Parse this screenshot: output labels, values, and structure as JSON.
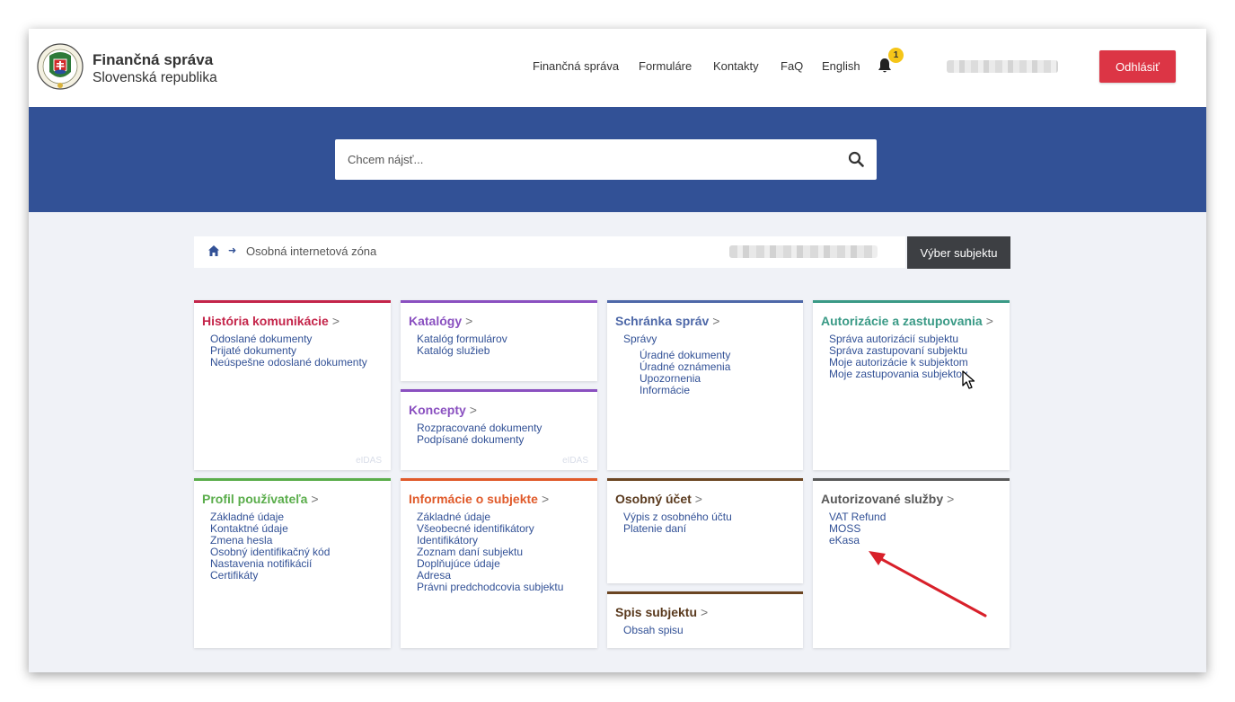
{
  "brand": {
    "title": "Finančná správa",
    "subtitle": "Slovenská republika"
  },
  "nav": [
    {
      "label": "Finančná správa"
    },
    {
      "label": "Formuláre"
    },
    {
      "label": "Kontakty"
    },
    {
      "label": "FaQ"
    },
    {
      "label": "English"
    }
  ],
  "notifications": {
    "count": "1"
  },
  "logout_label": "Odhlásiť",
  "search": {
    "placeholder": "Chcem nájsť..."
  },
  "breadcrumb": {
    "current": "Osobná internetová zóna"
  },
  "subject_button_label": "Výber subjektu",
  "eidas_label": "eIDAS",
  "colors": {
    "banner": "#325196",
    "logout": "#dc3545",
    "historia": "#c4254a",
    "katalogy": "#8a50c0",
    "schranka": "#4e68a8",
    "autorizacie": "#3a9a86",
    "profil": "#5aad4b",
    "informacie": "#e05a2a",
    "ucet": "#6b4522",
    "sluzby": "#595959",
    "link": "#325196"
  },
  "tiles": [
    {
      "title": "História komunikácie",
      "items": [
        "Odoslané dokumenty",
        "Prijaté dokumenty",
        "Neúspešne odoslané dokumenty"
      ]
    },
    {
      "title": "Katalógy",
      "items": [
        "Katalóg formulárov",
        "Katalóg služieb"
      ]
    },
    {
      "title": "Koncepty",
      "items": [
        "Rozpracované dokumenty",
        "Podpísané dokumenty"
      ]
    },
    {
      "title": "Schránka správ",
      "items": [
        "Správy",
        "Úradné dokumenty",
        "Úradné oznámenia",
        "Upozornenia",
        "Informácie"
      ]
    },
    {
      "title": "Autorizácie a zastupovania",
      "items": [
        "Správa autorizácií subjektu",
        "Správa zastupovaní subjektu",
        "Moje autorizácie k subjektom",
        "Moje zastupovania subjektov"
      ]
    },
    {
      "title": "Profil používateľa",
      "items": [
        "Základné údaje",
        "Kontaktné údaje",
        "Zmena hesla",
        "Osobný identifikačný kód",
        "Nastavenia notifikácií",
        "Certifikáty"
      ]
    },
    {
      "title": "Informácie o subjekte",
      "items": [
        "Základné údaje",
        "Všeobecné identifikátory",
        "Identifikátory",
        "Zoznam daní subjektu",
        "Doplňujúce údaje",
        "Adresa",
        "Právni predchodcovia subjektu"
      ]
    },
    {
      "title": "Osobný účet",
      "items": [
        "Výpis z osobného účtu",
        "Platenie daní"
      ]
    },
    {
      "title": "Spis subjektu",
      "items": [
        "Obsah spisu"
      ]
    },
    {
      "title": "Autorizované služby",
      "items": [
        "VAT Refund",
        "MOSS",
        "eKasa"
      ]
    }
  ],
  "tile_chevron": ">"
}
